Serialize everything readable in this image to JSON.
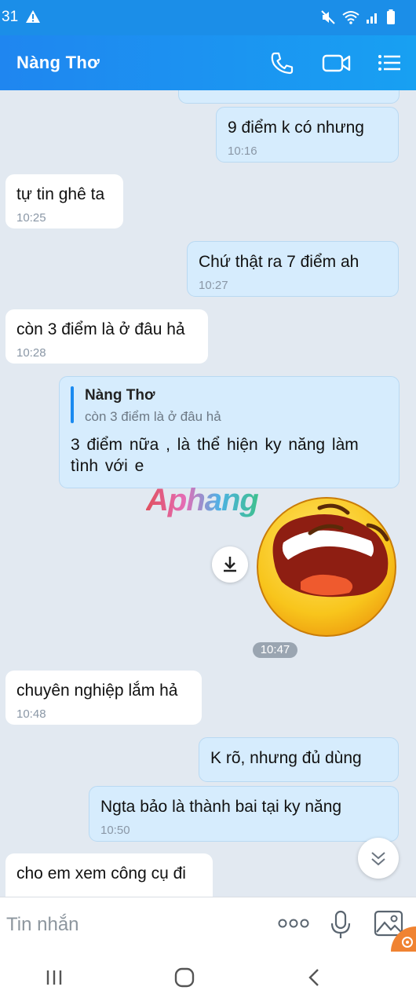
{
  "status_bar": {
    "time": "31"
  },
  "header": {
    "contact_name": "Nàng Thơ"
  },
  "messages": [
    {
      "direction": "out",
      "text": "9 điểm  k có  nhưng",
      "time": "10:16"
    },
    {
      "direction": "in",
      "text": "tự tin ghê ta",
      "time": "10:25"
    },
    {
      "direction": "out",
      "text": "Chứ  thật  ra  7 điểm  ah",
      "time": "10:27"
    },
    {
      "direction": "in",
      "text": "còn 3 điểm là ở đâu hả",
      "time": "10:28"
    },
    {
      "direction": "out",
      "reply_to_name": "Nàng  Thơ",
      "reply_to_text": "còn 3 điểm là ở đâu hả",
      "text": "3 điểm  nữa  , là  thể  hiện  ky năng  làm tình  với  e"
    },
    {
      "direction": "out",
      "type": "sticker",
      "time": "10:47"
    },
    {
      "direction": "in",
      "text": "chuyên nghiệp lắm hả",
      "time": "10:48"
    },
    {
      "direction": "out",
      "text": "K rõ,  nhưng  đủ  dùng"
    },
    {
      "direction": "out",
      "text": "Ngta  bảo  là  thành  bai  tại  ky năng",
      "time": "10:50"
    },
    {
      "direction": "in",
      "text": "cho em xem công cụ đi"
    }
  ],
  "watermark": "Aphang",
  "input": {
    "placeholder": "Tin nhắn"
  },
  "colors": {
    "header": "#1b8ee8",
    "bubble_out": "#d6ecfd",
    "bubble_in": "#ffffff",
    "background": "#e2e9f1",
    "accent": "#1a8af0"
  }
}
